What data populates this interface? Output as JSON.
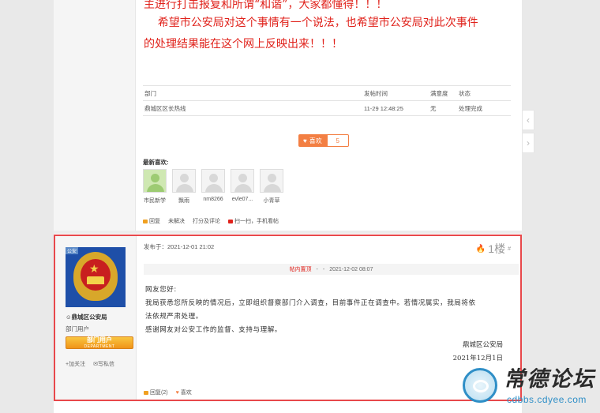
{
  "post1": {
    "text_line0": "主进行打击报复和所谓“和谐”，大家都懂得！！！",
    "text_line1": "    希望市公安局对这个事情有一个说法，也希望市公安局对此次事件",
    "text_line2": "的处理结果能在这个网上反映出来！！！",
    "table": {
      "headers": [
        "部门",
        "发帖时间",
        "满意度",
        "状态"
      ],
      "row": [
        "鼎城区区长热线",
        "11-29 12:48:25",
        "无",
        "处理完成"
      ]
    },
    "like_label": "喜欢",
    "like_count": "5",
    "likers_title": "最新喜欢:",
    "likers": [
      "市民新学",
      "飘雨",
      "nm8266",
      "evle07...",
      "小青草"
    ],
    "actions": [
      "回复",
      "未解决",
      "打分及评论",
      "扫一扫，手机看帖"
    ]
  },
  "post2": {
    "user_badge_tag": "公安",
    "username": "鼎城区公安局",
    "group": "部门用户",
    "rank_label": "部门用户",
    "rank_sub": "DEPARTMENT",
    "follow_label": "加关注",
    "message_label": "写私信",
    "posted_at": "发布于：2021-12-01 21:02",
    "floor": "1楼",
    "floor_sup": "#",
    "bar_highlight": "帖内置顶",
    "bar_sep": "-",
    "bar_time": "2021-12-02 08:07",
    "body_lines": [
      "网友您好:",
      "我局获悉您所反映的情况后，立即组织督察部门介入调查，目前事件正在调查中。若情况属实，我局将依",
      "法依规严肃处理。",
      "感谢网友对公安工作的监督、支持与理解。"
    ],
    "sign_org": "鼎城区公安局",
    "sign_date": "2021年12月1日",
    "reply_label": "回复(2)",
    "like_label": "喜欢"
  },
  "watermark": {
    "title": "常德论坛",
    "url": "cdbbs.cdyee.com"
  },
  "colors": {
    "accent": "#f37f43",
    "red_text": "#e0221b",
    "highlight_border": "#e8484b"
  }
}
